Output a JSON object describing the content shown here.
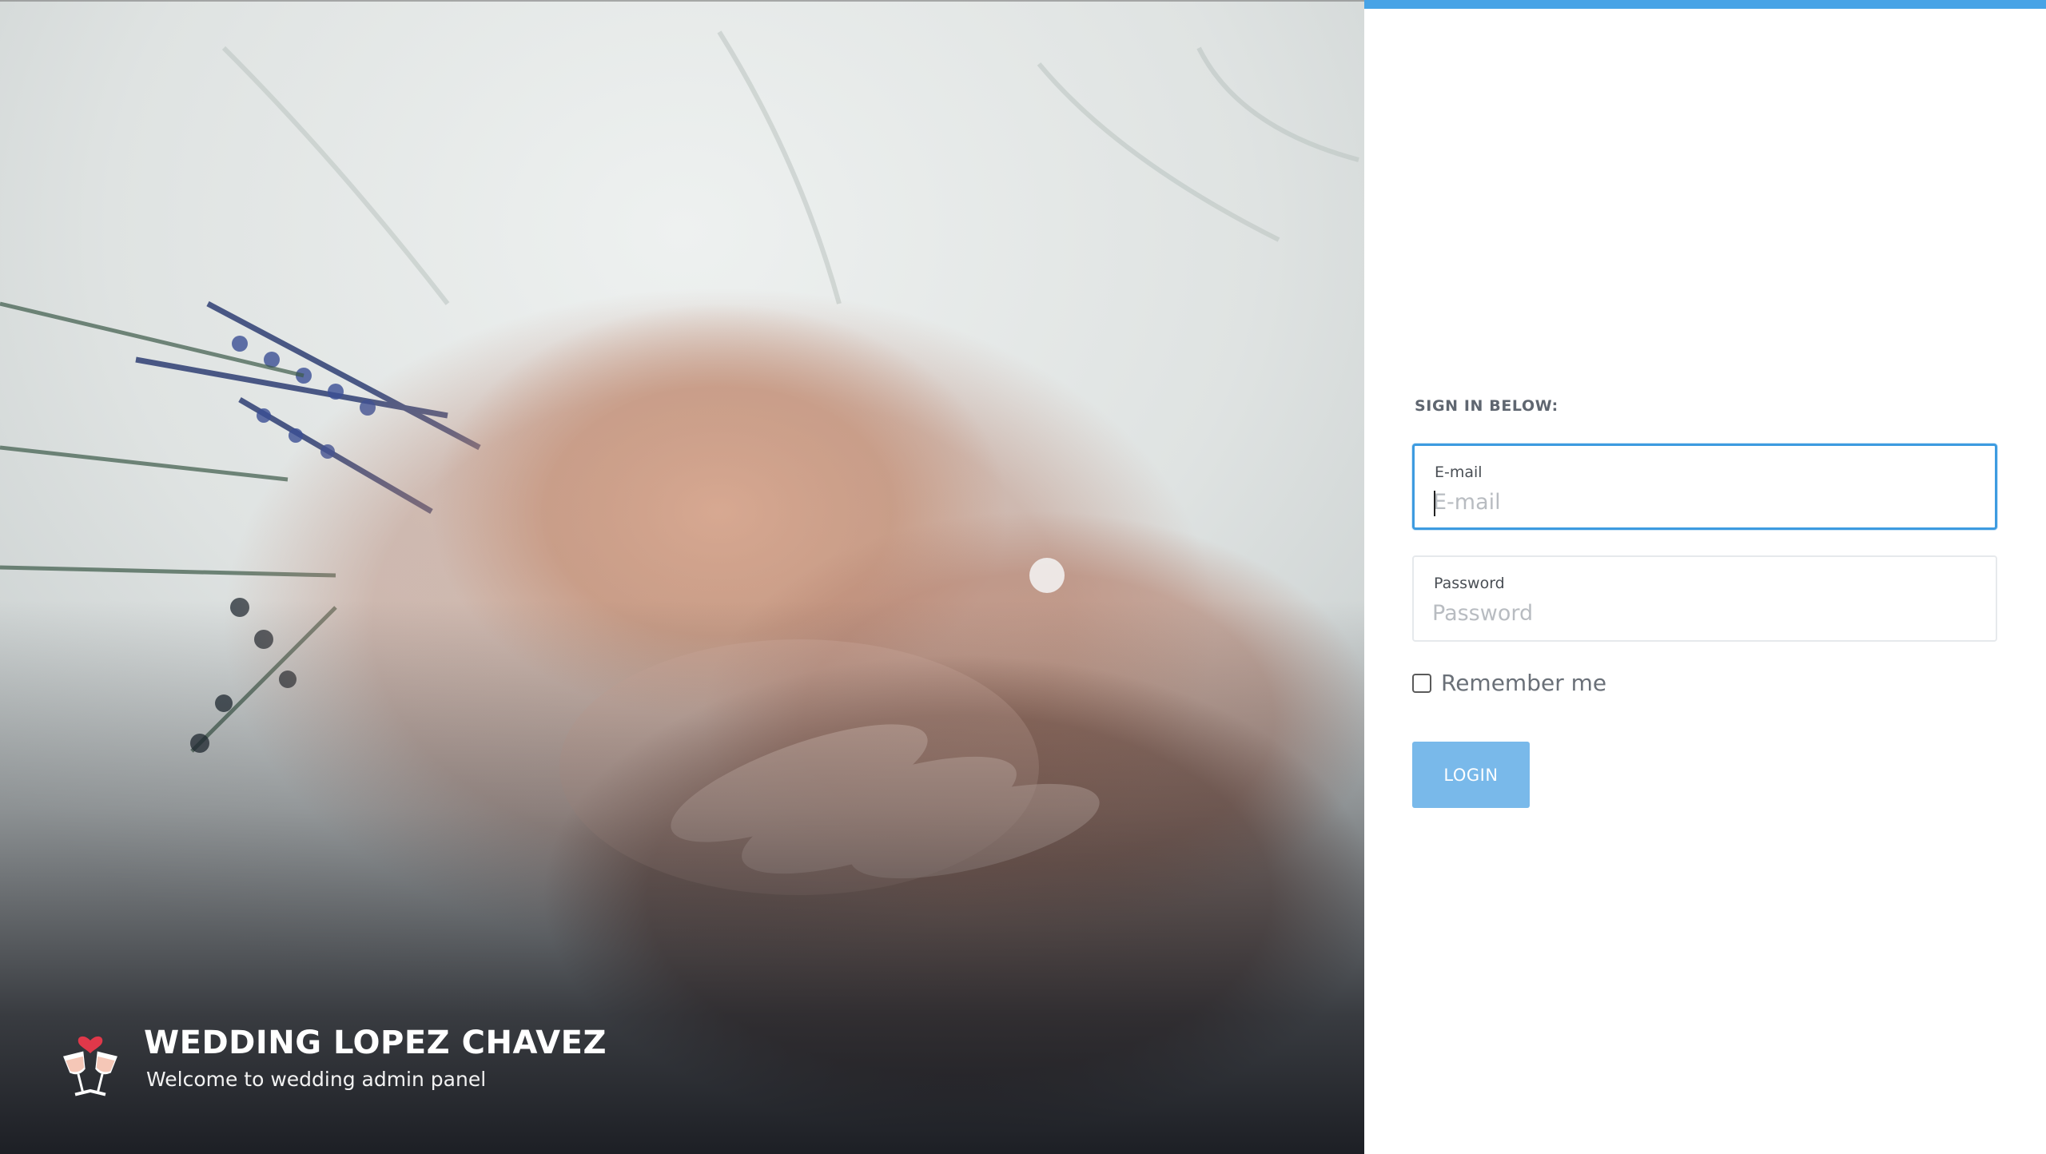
{
  "hero": {
    "title": "WEDDING LOPEZ CHAVEZ",
    "subtitle": "Welcome to wedding admin panel",
    "logo_icon": "champagne-toast-heart-icon"
  },
  "signin": {
    "heading": "SIGN IN BELOW:",
    "email": {
      "label": "E-mail",
      "placeholder": "E-mail",
      "value": ""
    },
    "password": {
      "label": "Password",
      "placeholder": "Password",
      "value": ""
    },
    "remember_label": "Remember me",
    "remember_checked": false,
    "login_label": "LOGIN"
  },
  "colors": {
    "accent": "#47a3e6",
    "focus_border": "#3d9be0",
    "button": "#79b9ea",
    "heart": "#e0384a"
  }
}
